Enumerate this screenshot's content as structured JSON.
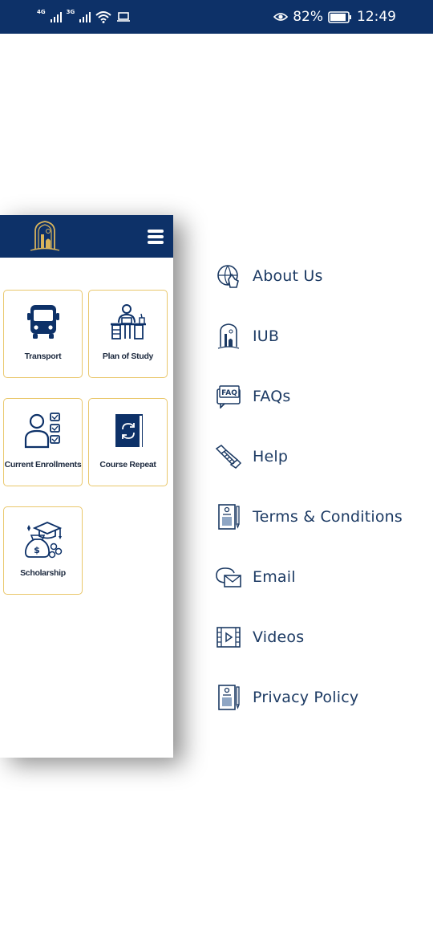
{
  "status_bar": {
    "net1": "4G",
    "net2": "3G",
    "battery_pct": "82%",
    "time": "12:49"
  },
  "tiles": [
    {
      "label": "Transport",
      "icon": "bus-icon"
    },
    {
      "label": "Plan of Study",
      "icon": "desk-study-icon"
    },
    {
      "label": "Current Enrollments",
      "icon": "enrollments-checklist-icon"
    },
    {
      "label": "Course Repeat",
      "icon": "book-repeat-icon"
    },
    {
      "label": "Scholarship",
      "icon": "scholarship-icon"
    }
  ],
  "menu": [
    {
      "label": "About Us",
      "icon": "globe-hand-icon"
    },
    {
      "label": "IUB",
      "icon": "iub-logo-icon"
    },
    {
      "label": "FAQs",
      "icon": "faq-icon"
    },
    {
      "label": "Help",
      "icon": "handshake-icon"
    },
    {
      "label": "Terms & Conditions",
      "icon": "document-pen-icon"
    },
    {
      "label": "Email",
      "icon": "email-icon"
    },
    {
      "label": "Videos",
      "icon": "video-icon"
    },
    {
      "label": "Privacy Policy",
      "icon": "document-pen-icon"
    }
  ],
  "colors": {
    "primary": "#0d3168",
    "tile_border": "#e9c76b",
    "menu_text": "#1c3a63"
  }
}
